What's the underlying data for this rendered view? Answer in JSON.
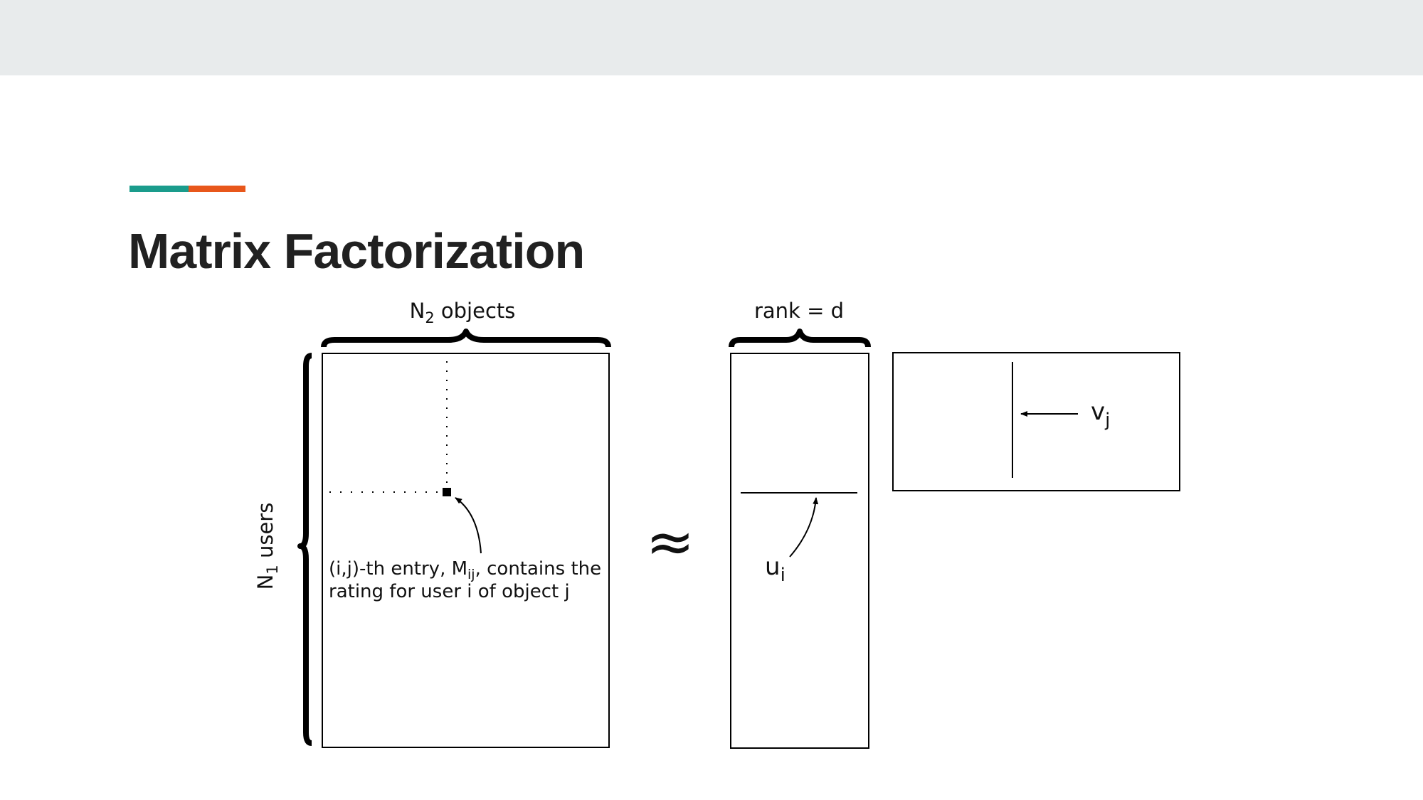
{
  "slide": {
    "title": "Matrix Factorization",
    "accent_colors": [
      "#1a9c8c",
      "#e8571b"
    ],
    "header_bar_color": "#e8ebec"
  },
  "diagram": {
    "top_brace_label": {
      "main": "N",
      "sub": "2",
      "rest": " objects"
    },
    "side_brace_label": {
      "main": "N",
      "sub": "1",
      "rest": " users"
    },
    "rank_label": "rank = d",
    "entry_caption_line1": {
      "pre": "(i,j)-th entry, M",
      "sub": "ij",
      "post": ", contains the"
    },
    "entry_caption_line2": "rating for user i of object j",
    "approx_symbol": "≈",
    "u_label": {
      "main": "u",
      "sub": "i"
    },
    "v_label": {
      "main": "v",
      "sub": "j"
    }
  }
}
